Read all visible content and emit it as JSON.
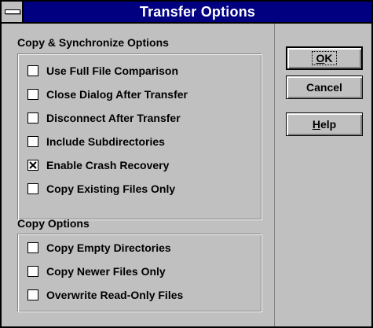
{
  "window": {
    "title": "Transfer Options"
  },
  "sync_options": {
    "heading": "Copy & Synchronize Options",
    "items": [
      {
        "label": "Use Full File Comparison",
        "checked": false
      },
      {
        "label": "Close Dialog After Transfer",
        "checked": false
      },
      {
        "label": "Disconnect After Transfer",
        "checked": false
      },
      {
        "label": "Include Subdirectories",
        "checked": false
      },
      {
        "label": "Enable Crash Recovery",
        "checked": true
      },
      {
        "label": "Copy Existing Files Only",
        "checked": false
      }
    ]
  },
  "copy_options": {
    "heading": "Copy Options",
    "items": [
      {
        "label": "Copy Empty Directories",
        "checked": false
      },
      {
        "label": "Copy Newer Files Only",
        "checked": false
      },
      {
        "label": "Overwrite Read-Only Files",
        "checked": false
      }
    ]
  },
  "buttons": {
    "ok": {
      "first": "O",
      "rest": "K"
    },
    "cancel": "Cancel",
    "help": {
      "first": "H",
      "rest": "elp"
    }
  },
  "colors": {
    "title_bar": "#000080",
    "face": "#c0c0c0"
  }
}
